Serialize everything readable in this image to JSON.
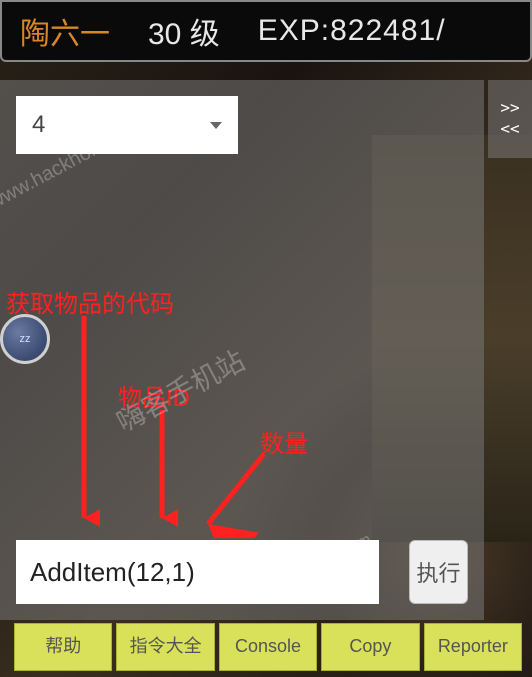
{
  "header": {
    "player_name": "陶六一",
    "level_text": "30 级",
    "exp_text": "EXP:822481/"
  },
  "side_toggle": {
    "line1": ">>",
    "line2": "<<"
  },
  "dropdown": {
    "value": "4"
  },
  "command": {
    "input_value": "AddItem(12,1)",
    "exec_label": "执行"
  },
  "bottom_buttons": [
    "帮助",
    "指令大全",
    "Console",
    "Copy",
    "Reporter"
  ],
  "annotations": {
    "code_label": "获取物品的代码",
    "item_id_label": "物品ID",
    "qty_label": "数量"
  },
  "watermarks": {
    "w1": "www.hackhome.com",
    "w2": "嗨客手机站",
    "w3": "www.hackhome.com"
  },
  "circle": {
    "label": "zz"
  }
}
